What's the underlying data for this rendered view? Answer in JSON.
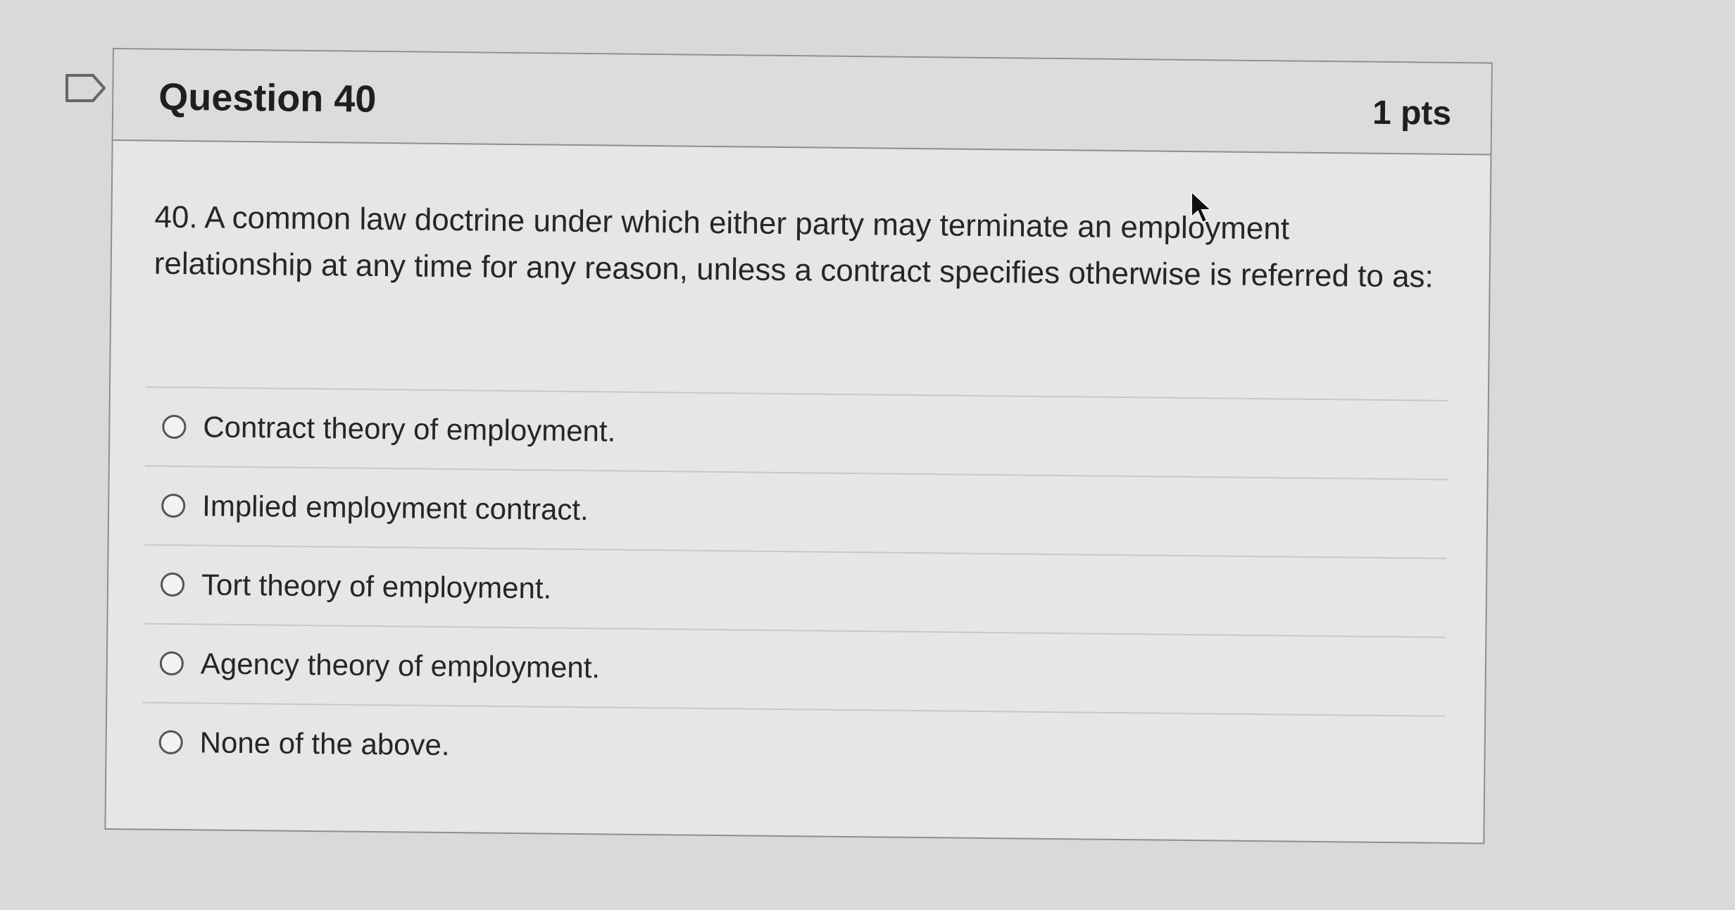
{
  "question": {
    "title": "Question 40",
    "points": "1 pts",
    "text": "40.  A common law doctrine under which either party may terminate an employment relationship at any time for any reason, unless a contract specifies otherwise is referred to as:"
  },
  "answers": [
    {
      "label": "Contract theory of employment."
    },
    {
      "label": "Implied employment contract."
    },
    {
      "label": "Tort theory of employment."
    },
    {
      "label": "Agency theory of employment."
    },
    {
      "label": "None of the above."
    }
  ],
  "icons": {
    "bookmark": "bookmark-flag-icon",
    "cursor": "mouse-pointer-icon"
  },
  "colors": {
    "page_background": "#d9d9d9",
    "card_background": "#e6e6e6",
    "border": "#8e8e8e"
  }
}
